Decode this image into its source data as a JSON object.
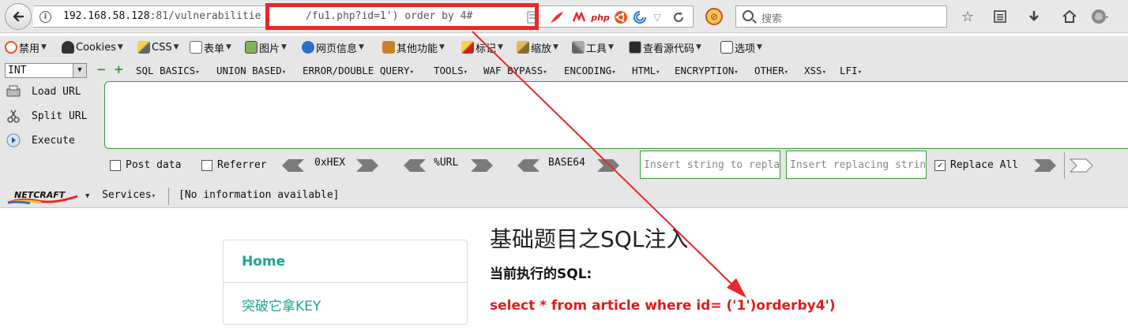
{
  "nav": {
    "url_host": "192.168.58.128",
    "url_port_path": ":81/vulnerabilitie",
    "url_query": "/fu1.php?id=1') order by 4#",
    "search_placeholder": "搜索",
    "php_label": "php"
  },
  "menubar": {
    "items": [
      {
        "label": "禁用",
        "icon": "disable-icon"
      },
      {
        "label": "Cookies",
        "icon": "cookie-icon"
      },
      {
        "label": "CSS",
        "icon": "css-icon"
      },
      {
        "label": "表单",
        "icon": "form-icon"
      },
      {
        "label": "图片",
        "icon": "image-icon"
      },
      {
        "label": "网页信息",
        "icon": "info-icon"
      },
      {
        "label": "其他功能",
        "icon": "misc-icon"
      },
      {
        "label": "标记",
        "icon": "mark-icon"
      },
      {
        "label": "缩放",
        "icon": "zoom-icon"
      },
      {
        "label": "工具",
        "icon": "tools-icon"
      },
      {
        "label": "查看源代码",
        "icon": "source-icon"
      },
      {
        "label": "选项",
        "icon": "options-icon"
      }
    ]
  },
  "hackbar": {
    "int_select": "INT",
    "menus": [
      "SQL BASICS",
      "UNION BASED",
      "ERROR/DOUBLE QUERY",
      "TOOLS",
      "WAF BYPASS",
      "ENCODING",
      "HTML",
      "ENCRYPTION",
      "OTHER",
      "XSS",
      "LFI"
    ],
    "load_url": "Load URL",
    "split_url": "Split URL",
    "execute": "Execute",
    "post_data": "Post data",
    "referrer": "Referrer",
    "hex": "0xHEX",
    "url": "%URL",
    "base64": "BASE64",
    "insert_string_placeholder": "Insert string to repla",
    "insert_replacing_placeholder": "Insert replacing strin",
    "replace_all": "Replace All"
  },
  "netcraft": {
    "logo_text": "NETCRAFT",
    "services": "Services",
    "info": "[No information available]"
  },
  "page": {
    "nav_items": [
      {
        "label": "Home"
      },
      {
        "label": "突破它拿KEY"
      }
    ],
    "title": "基础题目之SQL注入",
    "sql_label": "当前执行的SQL:",
    "sql_text": "select * from article where id= ('1')orderby4')"
  },
  "colors": {
    "highlight_red": "#e8262b",
    "link_teal": "#1aa39a",
    "sql_red": "#e01b1b",
    "hackbar_green": "#3a9a3a"
  }
}
